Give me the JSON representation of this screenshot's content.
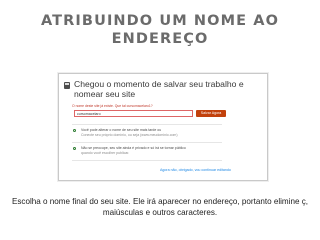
{
  "slide": {
    "title": "ATRIBUINDO UM NOME AO ENDEREÇO",
    "caption": "Escolha o nome final do seu site. Ele irá aparecer no endereço, portanto elimine ç, maiúsculas e outros caracteres."
  },
  "dialog": {
    "icon": "save-icon",
    "title": "Chegou o momento de salvar seu trabalho e nomear seu site",
    "error": "O nome deste site já existe. Que tal cursomacelaro1?",
    "input_value": "cursomacelaro",
    "save_label": "Salvar Agora",
    "options": [
      {
        "text": "Você pode alterar o nome de seu site mais tarde ou",
        "sub": "Conecte seu próprio domínio, ou seja (www.meudominio.com)"
      },
      {
        "text": "Não se preocupe, seu site ainda é privado e só irá se tornar público",
        "sub": "quando você escolher publicar."
      }
    ],
    "skip_label": "Agora não, obrigado, vou continuar editando"
  },
  "colors": {
    "title": "#6b6b6b",
    "save_button": "#c2410c",
    "error": "#c0392b",
    "link": "#1e88e5"
  }
}
